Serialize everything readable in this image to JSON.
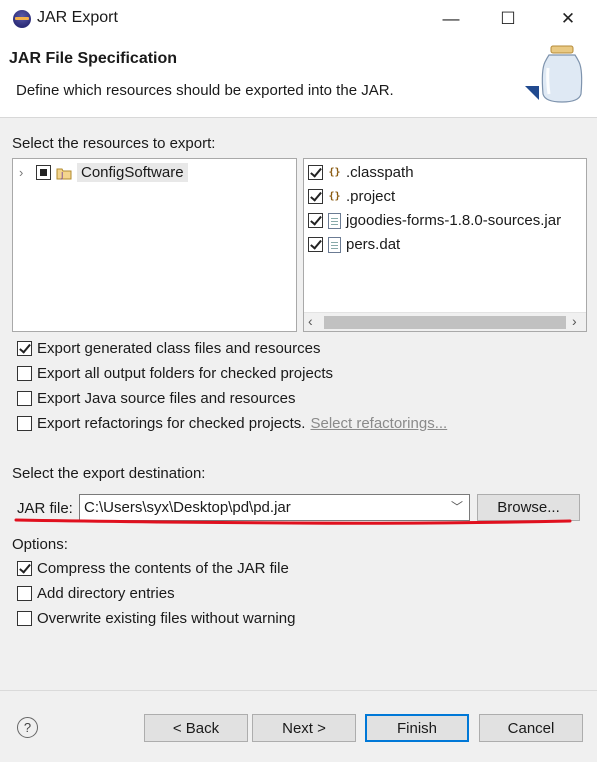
{
  "window": {
    "title": "JAR Export",
    "controls": {
      "minimize": "—",
      "maximize": "☐",
      "close": "✕"
    }
  },
  "banner": {
    "title": "JAR File Specification",
    "description": "Define which resources should be exported into the JAR."
  },
  "resources": {
    "label": "Select the resources to export:",
    "tree": [
      {
        "label": "ConfigSoftware",
        "state": "partial",
        "expanded": false
      }
    ],
    "files": [
      {
        "label": ".classpath",
        "checked": true,
        "icon": "xml-file-icon"
      },
      {
        "label": ".project",
        "checked": true,
        "icon": "xml-file-icon"
      },
      {
        "label": "jgoodies-forms-1.8.0-sources.jar",
        "checked": true,
        "icon": "file-icon"
      },
      {
        "label": "pers.dat",
        "checked": true,
        "icon": "file-icon"
      }
    ]
  },
  "export_options": [
    {
      "label": "Export generated class files and resources",
      "checked": true
    },
    {
      "label": "Export all output folders for checked projects",
      "checked": false
    },
    {
      "label": "Export Java source files and resources",
      "checked": false
    },
    {
      "label": "Export refactorings for checked projects.",
      "checked": false,
      "link": "Select refactorings..."
    }
  ],
  "destination": {
    "label": "Select the export destination:",
    "jar_label": "JAR file:",
    "jar_value": "C:\\Users\\syx\\Desktop\\pd\\pd.jar",
    "browse": "Browse..."
  },
  "options": {
    "label": "Options:",
    "items": [
      {
        "label": "Compress the contents of the JAR file",
        "checked": true
      },
      {
        "label": "Add directory entries",
        "checked": false
      },
      {
        "label": "Overwrite existing files without warning",
        "checked": false
      }
    ]
  },
  "footer": {
    "help": "?",
    "back": "< Back",
    "next": "Next >",
    "finish": "Finish",
    "cancel": "Cancel"
  },
  "colors": {
    "annotation": "#e0101e",
    "default_button_border": "#0078d7",
    "link": "#8a8a8a"
  }
}
